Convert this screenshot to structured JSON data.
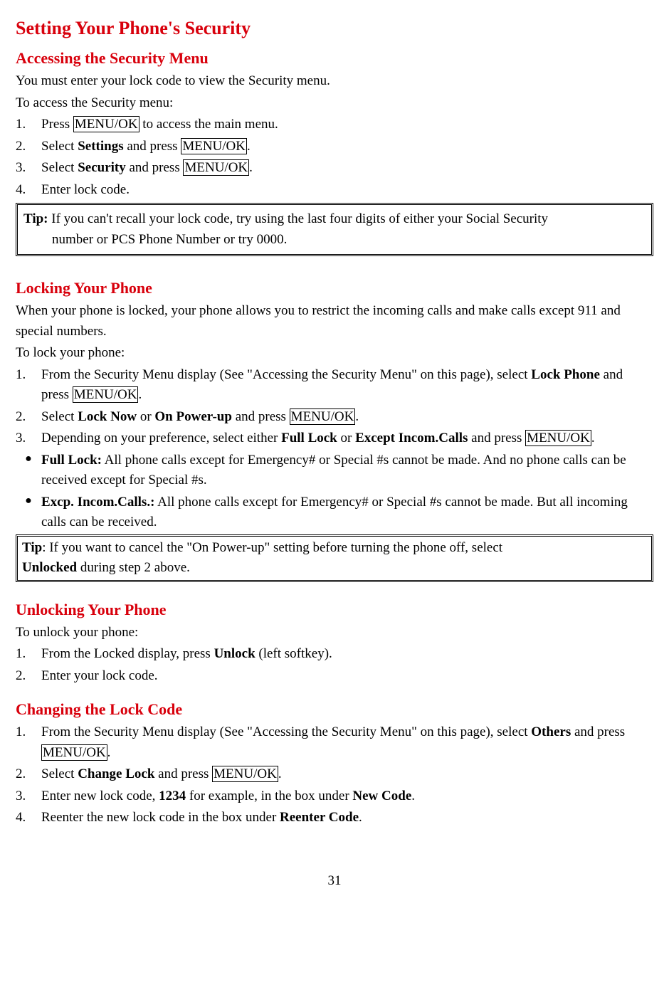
{
  "page_number": "31",
  "title": "Setting Your Phone's Security",
  "section1": {
    "heading": "Accessing the Security Menu",
    "intro1": "You must enter your lock code to view the Security menu.",
    "intro2": "To access the Security menu:",
    "step1_a": "Press ",
    "step1_key": "MENU/OK",
    "step1_b": " to access the main menu.",
    "step2_a": "Select ",
    "step2_bold": "Settings",
    "step2_b": " and press ",
    "step2_key": "MENU/OK",
    "step2_c": ".",
    "step3_a": "Select ",
    "step3_bold": "Security",
    "step3_b": " and press ",
    "step3_key": "MENU/OK",
    "step3_c": ".",
    "step4": "Enter lock code.",
    "tip_label": "Tip:",
    "tip_body": " If you can't recall your lock code, try using the last four digits of either your Social Security",
    "tip_body2": "number or PCS Phone Number or try 0000."
  },
  "section2": {
    "heading": "Locking Your Phone",
    "intro1": "When your phone is locked, your phone allows you to restrict the incoming calls and make calls except 911 and special numbers.",
    "intro2": "To lock your phone:",
    "step1_a": "From the Security Menu display (See \"Accessing the Security Menu\" on this page), select ",
    "step1_bold": "Lock Phone",
    "step1_b": " and press ",
    "step1_key": "MENU/OK",
    "step1_c": ".",
    "step2_a": "Select ",
    "step2_bold1": "Lock Now",
    "step2_mid": " or ",
    "step2_bold2": "On Power-up",
    "step2_b": " and press ",
    "step2_key": "MENU/OK",
    "step2_c": ".",
    "step3_a": "Depending on your preference, select either ",
    "step3_bold1": "Full Lock",
    "step3_mid": " or ",
    "step3_bold2": "Except Incom.Calls",
    "step3_b": " and press ",
    "step3_key": "MENU/OK",
    "step3_c": ".",
    "bullet1_bold": "Full Lock:",
    "bullet1_body": " All phone calls except for Emergency# or Special #s cannot be made. And no phone calls can be received except for Special #s.",
    "bullet2_bold": "Excp. Incom.Calls.:",
    "bullet2_body": " All phone calls except for Emergency# or Special #s cannot be made. But all incoming calls can be received.",
    "tip_label": "Tip",
    "tip_body": ": If you want to cancel the \"On Power-up\" setting before turning the phone off, select ",
    "tip_bold": "Unlocked",
    "tip_after": " during step 2 above."
  },
  "section3": {
    "heading": "Unlocking Your Phone",
    "intro": "To unlock your phone:",
    "step1_a": "From the Locked display, press ",
    "step1_bold": "Unlock",
    "step1_b": " (left softkey).",
    "step2": "Enter your lock code."
  },
  "section4": {
    "heading": "Changing the Lock Code",
    "step1_a": "From the Security Menu display (See \"Accessing the Security Menu\" on this page), select ",
    "step1_bold": "Others",
    "step1_b": " and press ",
    "step1_key": "MENU/OK",
    "step1_c": ".",
    "step2_a": "Select ",
    "step2_bold": "Change Lock",
    "step2_b": " and press ",
    "step2_key": "MENU/OK",
    "step2_c": ".",
    "step3_a": "Enter new lock code, ",
    "step3_bold1": "1234",
    "step3_mid": " for example, in the box under ",
    "step3_bold2": "New Code",
    "step3_c": ".",
    "step4_a": "Reenter the new lock code in the box under ",
    "step4_bold": "Reenter Code",
    "step4_b": "."
  },
  "numbers": {
    "1": "1.",
    "2": "2.",
    "3": "3.",
    "4": "4."
  },
  "bullet": "●"
}
